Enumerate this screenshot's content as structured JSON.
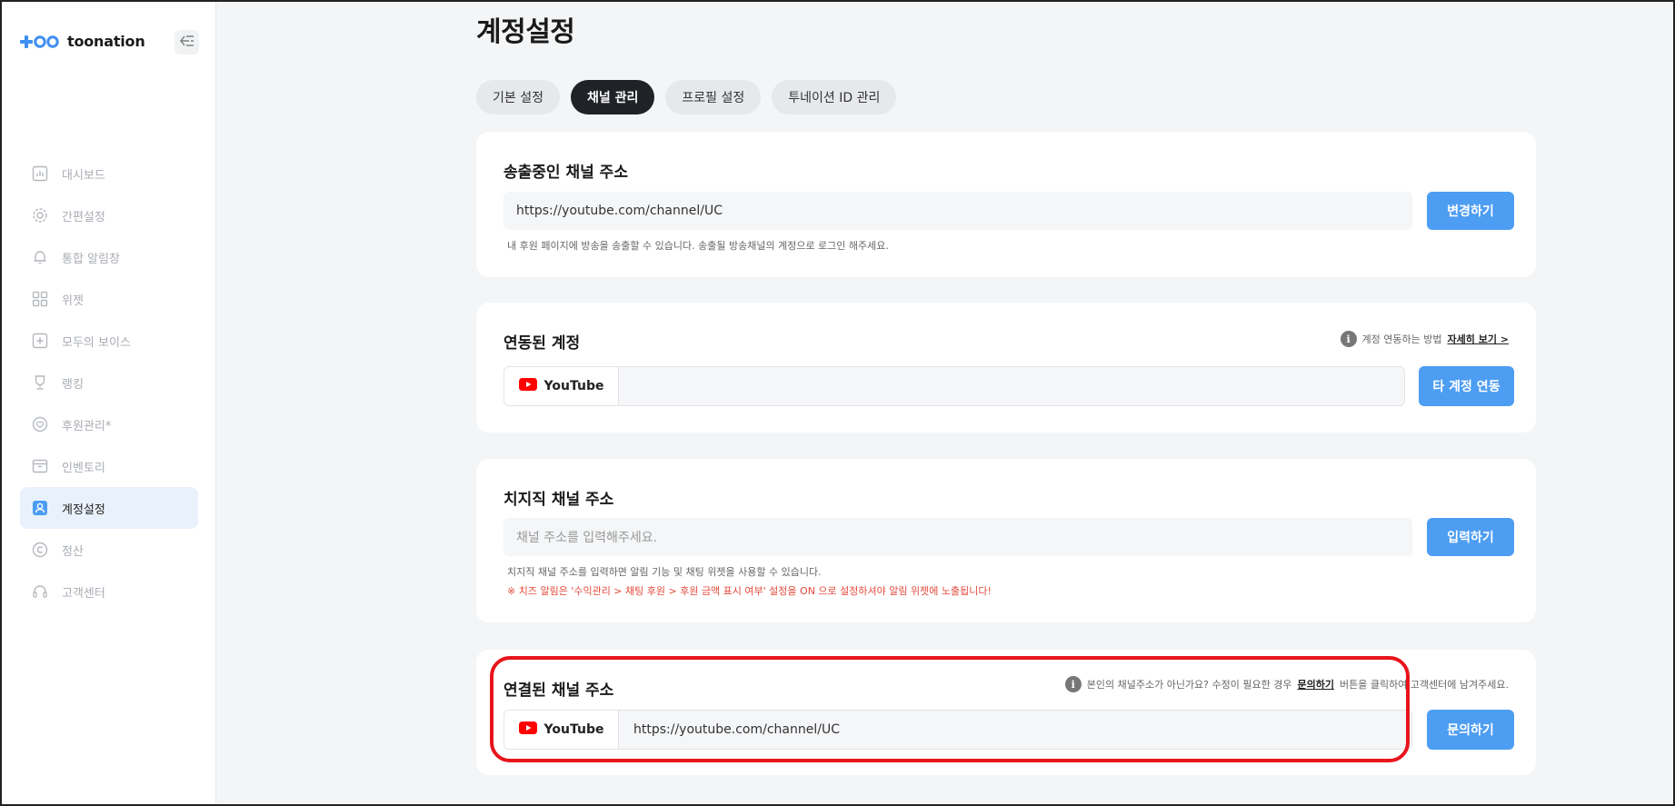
{
  "app": {
    "logo_text": "toonation"
  },
  "sidebar": {
    "items": [
      {
        "label": "대시보드",
        "icon": "dashboard-icon"
      },
      {
        "label": "간편설정",
        "icon": "gear-icon"
      },
      {
        "label": "통합 알림창",
        "icon": "bell-icon"
      },
      {
        "label": "위젯",
        "icon": "widget-grid-icon"
      },
      {
        "label": "모두의 보이스",
        "icon": "plus-box-icon"
      },
      {
        "label": "랭킹",
        "icon": "trophy-icon"
      },
      {
        "label": "후원관리*",
        "icon": "heart-icon"
      },
      {
        "label": "인벤토리",
        "icon": "box-icon"
      },
      {
        "label": "계정설정",
        "icon": "user-icon",
        "active": true
      },
      {
        "label": "정산",
        "icon": "copyright-icon"
      },
      {
        "label": "고객센터",
        "icon": "headset-icon"
      }
    ]
  },
  "page": {
    "title": "계정설정"
  },
  "tabs": [
    {
      "label": "기본 설정"
    },
    {
      "label": "채널 관리",
      "active": true
    },
    {
      "label": "프로필 설정"
    },
    {
      "label": "투네이션 ID 관리"
    }
  ],
  "broadcast_card": {
    "title": "송출중인 채널 주소",
    "value": "https://youtube.com/channel/UC",
    "button": "변경하기",
    "help": "내 후원 페이지에 방송을 송출할 수 있습니다. 송출될 방송채널의 계정으로 로그인 해주세요."
  },
  "linked_account_card": {
    "title": "연동된 계정",
    "info_text": "계정 연동하는 방법",
    "info_link": "자세히 보기 >",
    "platform": "YouTube",
    "button": "타 계정 연동"
  },
  "chzzk_card": {
    "title": "치지직 채널 주소",
    "placeholder": "채널 주소를 입력해주세요.",
    "button": "입력하기",
    "help": "치지직 채널 주소를 입력하면 알림 기능 및 채팅 위젯을 사용할 수 있습니다.",
    "warning": "※ 치즈 알림은 '수익관리 > 채팅 후원 > 후원 금액 표시 여부' 설정을 ON 으로 설정하셔야 알림 위젯에 노출됩니다!"
  },
  "connected_channel_card": {
    "title": "연결된 채널 주소",
    "info_prefix": "본인의 채널주소가 아닌가요? 수정이 필요한 경우",
    "info_link": "문의하기",
    "info_suffix": "버튼을 클릭하여 고객센터에 남겨주세요.",
    "platform": "YouTube",
    "value": "https://youtube.com/channel/UC",
    "button": "문의하기"
  },
  "colors": {
    "accent": "#4d9df2",
    "active_tab": "#1f2227",
    "highlight": "#e8141c",
    "youtube": "#ff0000"
  }
}
